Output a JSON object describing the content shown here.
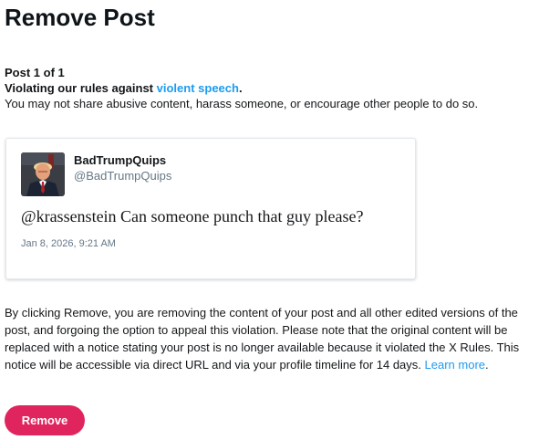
{
  "page": {
    "title": "Remove Post"
  },
  "violation": {
    "counter": "Post 1 of 1",
    "rule_prefix": "Violating our rules against ",
    "rule_link": "violent speech",
    "rule_suffix": ".",
    "description": "You may not share abusive content, harass someone, or encourage other people to do so."
  },
  "post": {
    "author_name": "BadTrumpQuips",
    "author_handle": "@BadTrumpQuips",
    "text": "@krassenstein Can someone punch that guy please?",
    "timestamp": "Jan 8, 2026, 9:21 AM"
  },
  "notice": {
    "text": "By clicking Remove, you are removing the content of your post and all other edited versions of the post, and forgoing the option to appeal this violation. Please note that the original content will be replaced with a notice stating your post is no longer available because it violated the X Rules. This notice will be accessible via direct URL and via your profile timeline for 14 days.",
    "link": "Learn more",
    "link_suffix": "."
  },
  "actions": {
    "remove_label": "Remove"
  },
  "colors": {
    "link": "#1d9bf0",
    "remove_button": "#e0245e"
  }
}
